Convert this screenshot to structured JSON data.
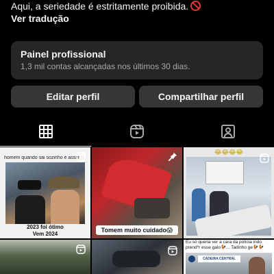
{
  "bio": {
    "line": "Aqui, a seriedade é estritamente proibida.",
    "translate_label": "Ver tradução"
  },
  "professional_panel": {
    "title": "Painel profissional",
    "subtitle": "1,3 mil contas alcançadas nos últimos 30 dias."
  },
  "buttons": {
    "edit_profile": "Editar perfil",
    "share_profile": "Compartilhar perfil"
  },
  "tabs": [
    {
      "icon": "grid-icon",
      "active": true
    },
    {
      "icon": "reels-icon",
      "active": false
    },
    {
      "icon": "tagged-icon",
      "active": false
    }
  ],
  "posts": [
    {
      "top_text": "homem quando sai sozinho é assim",
      "bottom_text": "2023 foi ótimo\nVem 2024"
    },
    {
      "caption": "Tomem muito cuidado😱"
    },
    {
      "top_text": "😂😂😂😂"
    },
    {},
    {},
    {
      "top_text": "Eu só queria ver a cara da polícia indo prend*r esse galo🐓... Tadinho ge🐓🐓",
      "sign_text": "CADEIRA CENTRAL"
    }
  ],
  "colors": {
    "background": "#000000",
    "panel": "#262626",
    "button": "#363636",
    "text": "#f5f5f5",
    "muted": "#a8a8a8"
  }
}
